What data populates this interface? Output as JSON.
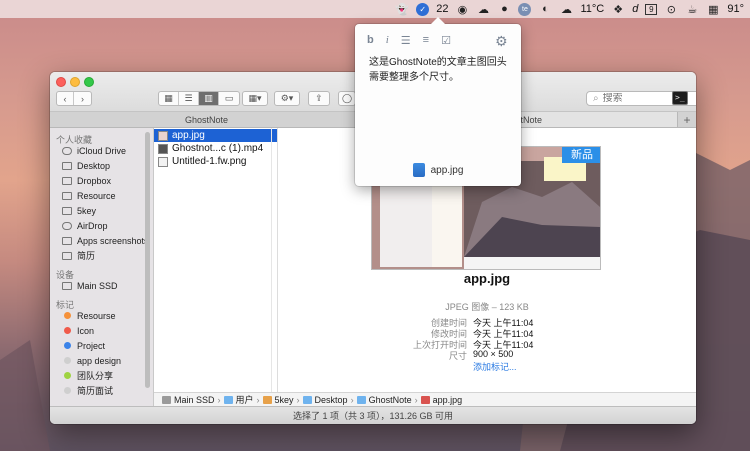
{
  "menubar": {
    "items": [
      {
        "icon": "ghostnote-icon"
      },
      {
        "icon": "badge-blue-icon"
      },
      {
        "icon": "notification-icon",
        "text": "22"
      },
      {
        "icon": "qq-icon"
      },
      {
        "icon": "wechat-icon"
      },
      {
        "icon": "message-icon"
      },
      {
        "icon": "te-icon",
        "text": "te"
      },
      {
        "icon": "evernote-icon"
      },
      {
        "icon": "weather-icon",
        "text": "11°C"
      },
      {
        "icon": "dropbox-icon"
      },
      {
        "icon": "dictionary-icon",
        "text": "d"
      },
      {
        "icon": "calendar-icon",
        "text": "9"
      },
      {
        "icon": "camera-icon"
      },
      {
        "icon": "coffee-icon"
      },
      {
        "icon": "battery-icon",
        "text": "91°"
      }
    ]
  },
  "popover": {
    "toolbar": [
      "b",
      "i",
      "☰",
      "≡",
      "☑"
    ],
    "note_text": "这是GhostNote的文章主图回头需要整理多个尺寸。",
    "file_name": "app.jpg"
  },
  "window": {
    "tabs": [
      "GhostNote",
      "GhostNote"
    ],
    "search_placeholder": "搜索",
    "sidebar": {
      "favorites_title": "个人收藏",
      "favorites": [
        "iCloud Drive",
        "Desktop",
        "Dropbox",
        "Resource",
        "5key",
        "AirDrop",
        "Apps screenshots",
        "简历"
      ],
      "devices_title": "设备",
      "devices": [
        "Main SSD"
      ],
      "tags_title": "标记",
      "tags": [
        {
          "label": "Resourse",
          "color": "#f5913a"
        },
        {
          "label": "Icon",
          "color": "#f05a4a"
        },
        {
          "label": "Project",
          "color": "#3b83e8"
        },
        {
          "label": "app design",
          "color": "#cfcfcf"
        },
        {
          "label": "团队分享",
          "color": "#9fd342"
        },
        {
          "label": "简历面试",
          "color": "#cfcfcf"
        }
      ]
    },
    "files": [
      {
        "name": "app.jpg",
        "selected": true
      },
      {
        "name": "Ghostnot...c (1).mp4",
        "selected": false
      },
      {
        "name": "Untitled-1.fw.png",
        "selected": false
      }
    ],
    "preview": {
      "title": "app.jpg",
      "badge": "新品",
      "meta": [
        {
          "key": "",
          "value": "JPEG 图像 – 123 KB"
        },
        {
          "key": "创建时间",
          "value": "今天 上午11:04"
        },
        {
          "key": "修改时间",
          "value": "今天 上午11:04"
        },
        {
          "key": "上次打开时间",
          "value": "今天 上午11:04"
        },
        {
          "key": "尺寸",
          "value": "900 × 500"
        }
      ],
      "add_tag": "添加标记..."
    },
    "path": [
      "Main SSD",
      "用户",
      "5key",
      "Desktop",
      "GhostNote",
      "app.jpg"
    ],
    "status": "选择了 1 项（共 3 项），131.26 GB 可用"
  }
}
